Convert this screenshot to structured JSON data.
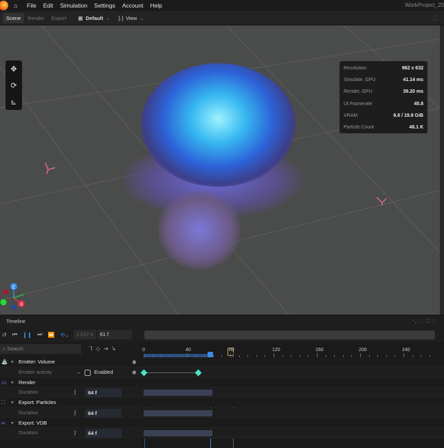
{
  "menubar": {
    "items": [
      "File",
      "Edit",
      "Simulation",
      "Settings",
      "Account",
      "Help"
    ],
    "project_title": "WorkProject_20"
  },
  "toolbar": {
    "tabs": [
      "Scene",
      "Render",
      "Export"
    ],
    "preset": "Default",
    "view": "View"
  },
  "stats": [
    {
      "k": "Resolution",
      "v": "962 x 632"
    },
    {
      "k": "Simulate, GPU",
      "v": "41.14 ms"
    },
    {
      "k": "Render, GPU",
      "v": "39.20 ms"
    },
    {
      "k": "UI Framerate",
      "v": "45.8"
    },
    {
      "k": "VRAM",
      "v": "6.6 / 19.8 GiB"
    },
    {
      "k": "Particle Count",
      "v": "48.1 K"
    }
  ],
  "gizmo": {
    "z": "Z",
    "y": "Y",
    "x": "X"
  },
  "timeline": {
    "title": "Timeline",
    "time": "1.017 s",
    "frame": "61 f",
    "search_placeholder": "Search",
    "ticks": [
      "0",
      "40",
      "80",
      "120",
      "160",
      "200",
      "240"
    ],
    "playhead_frame": 61,
    "rows": [
      {
        "label": "Emitter: Volume"
      },
      {
        "label": "Emitter activity",
        "checkbox": "Enabled",
        "keyframes": [
          0,
          50
        ]
      },
      {
        "label": "Render"
      },
      {
        "label": "Duration",
        "value": "64 f"
      },
      {
        "label": "Export: Particles"
      },
      {
        "label": "Duration",
        "value": "64 f"
      },
      {
        "label": "Export: VDB"
      },
      {
        "label": "Duration",
        "value": "64 f"
      }
    ]
  }
}
